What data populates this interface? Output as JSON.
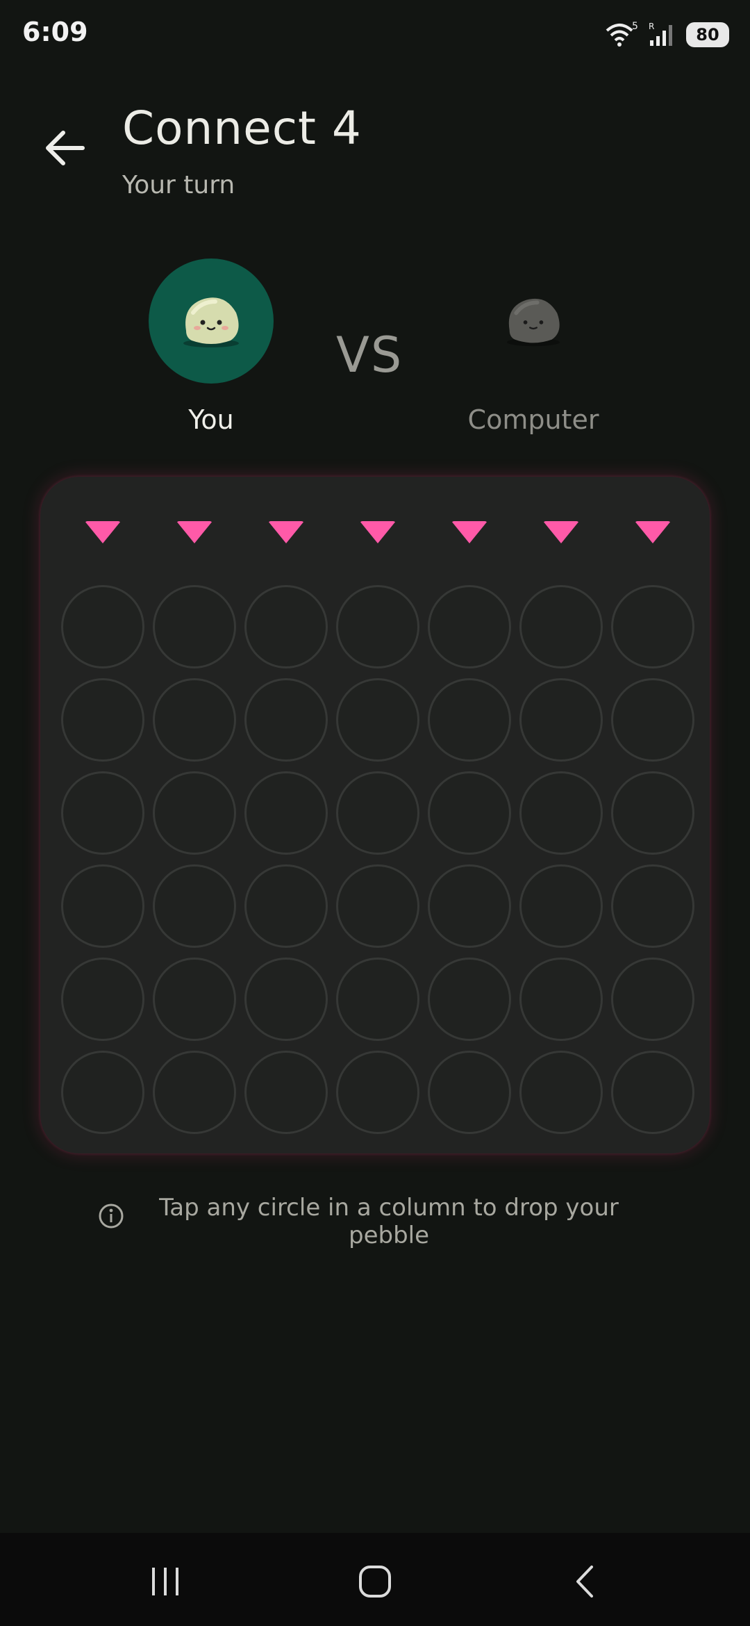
{
  "status_bar": {
    "time": "6:09",
    "battery": "80",
    "wifi_label": "5",
    "signal_label": "R"
  },
  "header": {
    "title": "Connect 4",
    "subtitle": "Your turn",
    "back_icon": "arrow-left-icon"
  },
  "players": {
    "you": {
      "name": "You",
      "active": true,
      "avatar": "green-pebble"
    },
    "vs": "VS",
    "computer": {
      "name": "Computer",
      "active": false,
      "avatar": "grey-pebble"
    }
  },
  "board": {
    "columns": 7,
    "rows": 6,
    "arrow_color": "#ff5aa8",
    "cells": "empty"
  },
  "hint": {
    "icon": "info-icon",
    "text": "Tap any circle in a column to drop your pebble"
  },
  "nav": {
    "recents_icon": "recents-icon",
    "home_icon": "home-icon",
    "back_icon": "back-chevron-icon"
  }
}
